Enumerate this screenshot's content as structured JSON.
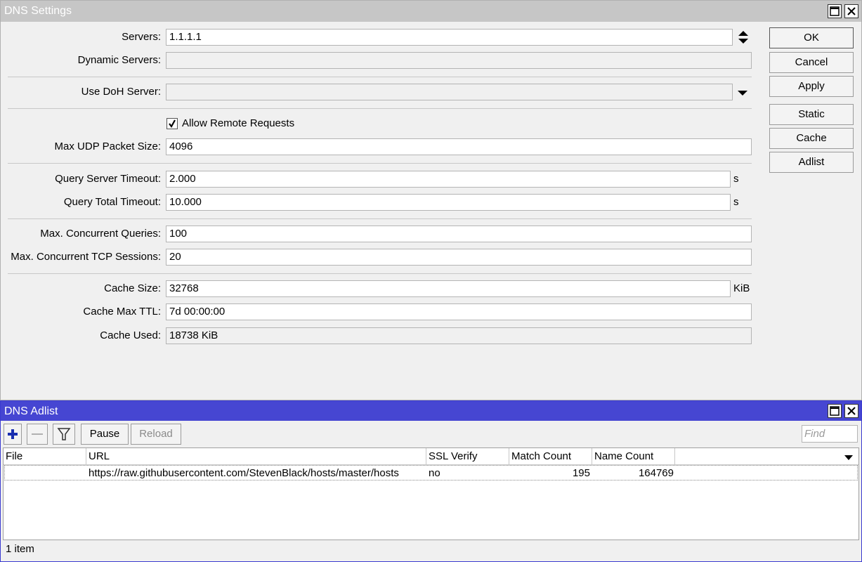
{
  "dns_settings": {
    "title": "DNS Settings",
    "fields": {
      "servers": {
        "label": "Servers:",
        "value": "1.1.1.1"
      },
      "dynamic_servers": {
        "label": "Dynamic Servers:",
        "value": ""
      },
      "use_doh_server": {
        "label": "Use DoH Server:",
        "value": ""
      },
      "allow_remote_requests": {
        "label": "Allow Remote Requests",
        "checked": true
      },
      "max_udp_packet_size": {
        "label": "Max UDP Packet Size:",
        "value": "4096"
      },
      "query_server_timeout": {
        "label": "Query Server Timeout:",
        "value": "2.000",
        "unit": "s"
      },
      "query_total_timeout": {
        "label": "Query Total Timeout:",
        "value": "10.000",
        "unit": "s"
      },
      "max_concurrent_queries": {
        "label": "Max. Concurrent Queries:",
        "value": "100"
      },
      "max_concurrent_tcp_sessions": {
        "label": "Max. Concurrent TCP Sessions:",
        "value": "20"
      },
      "cache_size": {
        "label": "Cache Size:",
        "value": "32768",
        "unit": "KiB"
      },
      "cache_max_ttl": {
        "label": "Cache Max TTL:",
        "value": "7d 00:00:00"
      },
      "cache_used": {
        "label": "Cache Used:",
        "value": "18738 KiB"
      }
    },
    "buttons": {
      "ok": "OK",
      "cancel": "Cancel",
      "apply": "Apply",
      "static": "Static",
      "cache": "Cache",
      "adlist": "Adlist"
    }
  },
  "dns_adlist": {
    "title": "DNS Adlist",
    "toolbar": {
      "pause": "Pause",
      "reload": "Reload",
      "find_placeholder": "Find"
    },
    "columns": [
      "File",
      "URL",
      "SSL Verify",
      "Match Count",
      "Name Count"
    ],
    "rows": [
      {
        "file": "",
        "url": "https://raw.githubusercontent.com/StevenBlack/hosts/master/hosts",
        "ssl_verify": "no",
        "match_count": "195",
        "name_count": "164769"
      }
    ],
    "status": "1 item"
  },
  "colors": {
    "adlist_titlebar": "#4646d2",
    "settings_titlebar": "#c6c6c6",
    "add_icon": "#1a2fb0"
  },
  "icons": [
    "maximize-icon",
    "close-icon",
    "up-down-arrows-icon",
    "dropdown-arrow-icon",
    "checkmark-icon",
    "plus-icon",
    "minus-icon",
    "filter-icon",
    "column-dropdown-icon"
  ]
}
